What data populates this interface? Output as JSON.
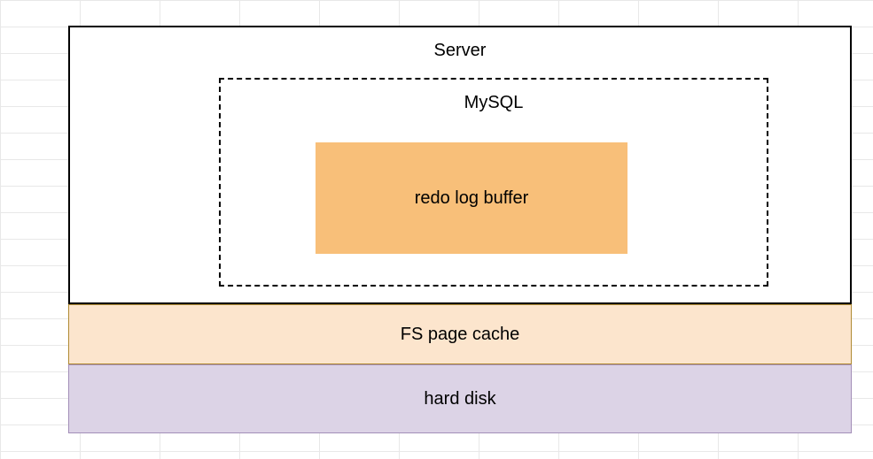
{
  "diagram": {
    "server": {
      "label": "Server",
      "mysql": {
        "label": "MySQL",
        "redo_log_buffer": {
          "label": "redo log buffer"
        }
      }
    },
    "fs_page_cache": {
      "label": "FS page cache"
    },
    "hard_disk": {
      "label": "hard disk"
    }
  },
  "colors": {
    "redo_buffer_bg": "#f8bf79",
    "fs_cache_bg": "#fce5cd",
    "fs_cache_border": "#b08b34",
    "hard_disk_bg": "#dcd3e6",
    "hard_disk_border": "#a38fb8"
  }
}
